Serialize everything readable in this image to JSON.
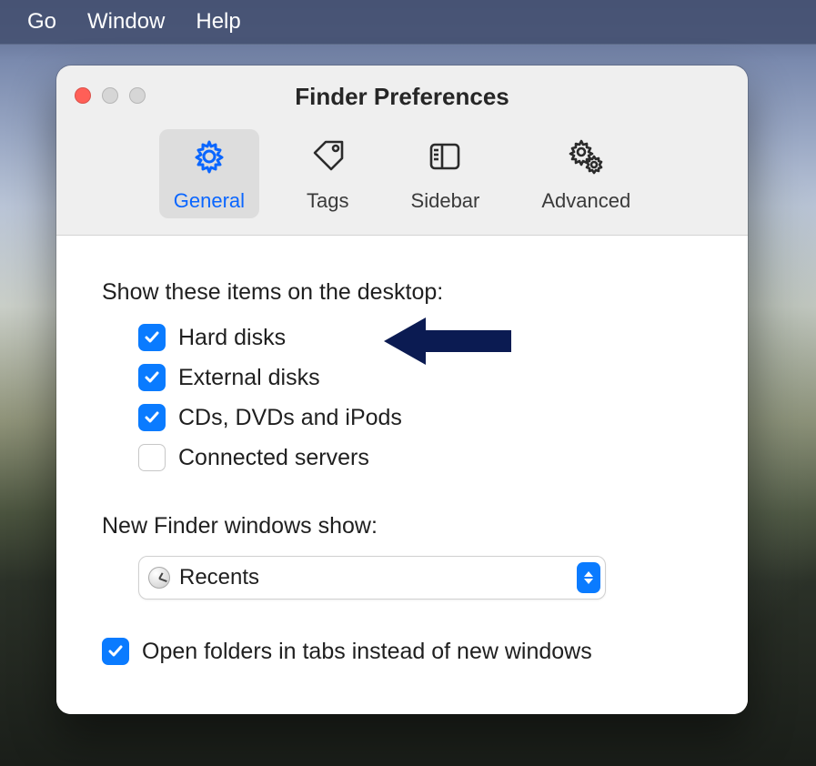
{
  "menubar": {
    "items": [
      "Go",
      "Window",
      "Help"
    ]
  },
  "window": {
    "title": "Finder Preferences",
    "tabs": [
      {
        "label": "General",
        "icon": "gear-icon",
        "active": true
      },
      {
        "label": "Tags",
        "icon": "tag-icon",
        "active": false
      },
      {
        "label": "Sidebar",
        "icon": "sidebar-icon",
        "active": false
      },
      {
        "label": "Advanced",
        "icon": "gears-icon",
        "active": false
      }
    ]
  },
  "desktop_section": {
    "heading": "Show these items on the desktop:",
    "items": [
      {
        "label": "Hard disks",
        "checked": true
      },
      {
        "label": "External disks",
        "checked": true
      },
      {
        "label": "CDs, DVDs and iPods",
        "checked": true
      },
      {
        "label": "Connected servers",
        "checked": false
      }
    ]
  },
  "new_windows": {
    "heading": "New Finder windows show:",
    "selected": "Recents"
  },
  "tabs_option": {
    "checked": true,
    "label": "Open folders in tabs instead of new windows"
  }
}
